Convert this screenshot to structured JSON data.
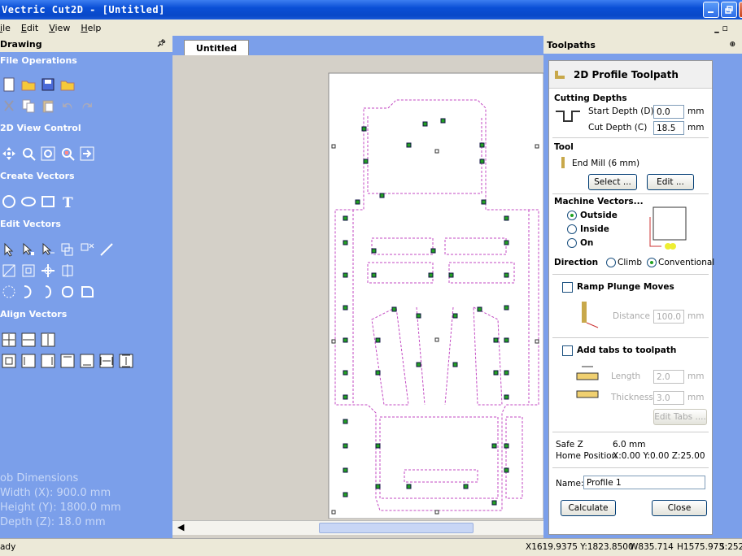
{
  "window": {
    "title": "Vectric Cut2D - [Untitled]"
  },
  "menu": [
    "ile",
    "Edit",
    "View",
    "Help"
  ],
  "left_panel": {
    "title": "Drawing",
    "pin": "ᵖ",
    "sections": {
      "file_ops": "File Operations",
      "view_control": "2D View Control",
      "create_vectors": "Create Vectors",
      "edit_vectors": "Edit Vectors",
      "align_vectors": "Align Vectors"
    },
    "job_dims": {
      "heading": "ob Dimensions",
      "width": "Width  (X): 900.0 mm",
      "height": "Height (Y): 1800.0 mm",
      "depth": "Depth  (Z): 18.0 mm"
    }
  },
  "doc": {
    "tab": "Untitled"
  },
  "right_panel": {
    "title": "Toolpaths",
    "heading": "2D Profile Toolpath",
    "cutting_depths": "Cutting Depths",
    "start_depth_label": "Start Depth (D)",
    "start_depth_value": "0.0",
    "cut_depth_label": "Cut Depth (C)",
    "cut_depth_value": "18.5",
    "unit": "mm",
    "tool_label": "Tool",
    "tool_name": "End Mill (6 mm)",
    "select_btn": "Select ...",
    "edit_btn": "Edit ...",
    "machine_vectors": "Machine Vectors...",
    "outside": "Outside",
    "inside": "Inside",
    "on": "On",
    "direction": "Direction",
    "climb": "Climb",
    "conventional": "Conventional",
    "ramp": "Ramp Plunge Moves",
    "distance_label": "Distance",
    "distance_value": "100.0",
    "tabs": "Add tabs to toolpath",
    "length_label": "Length",
    "length_value": "2.0",
    "thickness_label": "Thickness",
    "thickness_value": "3.0",
    "edit_tabs": "Edit Tabs ....",
    "safe_z_label": "Safe Z",
    "safe_z_value": "6.0 mm",
    "home_label": "Home Position",
    "home_value": "X:0.00 Y:0.00 Z:25.00",
    "name_label": "Name:",
    "name_value": "Profile 1",
    "calculate": "Calculate",
    "close": "Close"
  },
  "status": {
    "left": "ady",
    "coords": "X1619.9375 Y:1823.8500",
    "w": "W835.714",
    "h": "H1575.973",
    "s": "S:252"
  }
}
